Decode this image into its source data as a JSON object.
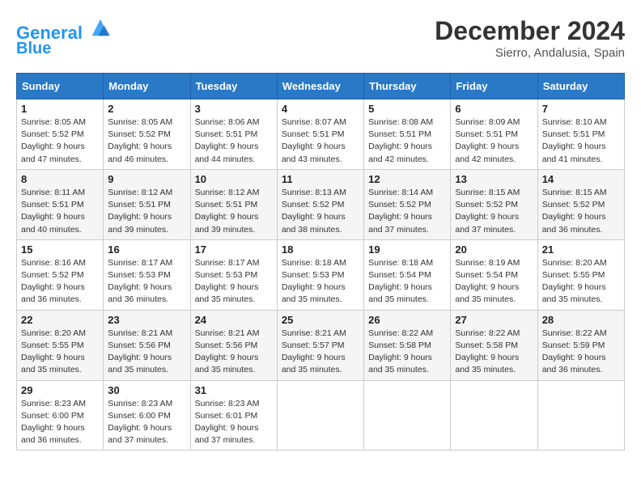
{
  "header": {
    "logo_line1": "General",
    "logo_line2": "Blue",
    "month_title": "December 2024",
    "location": "Sierro, Andalusia, Spain"
  },
  "calendar": {
    "headers": [
      "Sunday",
      "Monday",
      "Tuesday",
      "Wednesday",
      "Thursday",
      "Friday",
      "Saturday"
    ],
    "weeks": [
      [
        {
          "day": "1",
          "sunrise": "8:05 AM",
          "sunset": "5:52 PM",
          "daylight": "9 hours and 47 minutes."
        },
        {
          "day": "2",
          "sunrise": "8:05 AM",
          "sunset": "5:52 PM",
          "daylight": "9 hours and 46 minutes."
        },
        {
          "day": "3",
          "sunrise": "8:06 AM",
          "sunset": "5:51 PM",
          "daylight": "9 hours and 44 minutes."
        },
        {
          "day": "4",
          "sunrise": "8:07 AM",
          "sunset": "5:51 PM",
          "daylight": "9 hours and 43 minutes."
        },
        {
          "day": "5",
          "sunrise": "8:08 AM",
          "sunset": "5:51 PM",
          "daylight": "9 hours and 42 minutes."
        },
        {
          "day": "6",
          "sunrise": "8:09 AM",
          "sunset": "5:51 PM",
          "daylight": "9 hours and 42 minutes."
        },
        {
          "day": "7",
          "sunrise": "8:10 AM",
          "sunset": "5:51 PM",
          "daylight": "9 hours and 41 minutes."
        }
      ],
      [
        {
          "day": "8",
          "sunrise": "8:11 AM",
          "sunset": "5:51 PM",
          "daylight": "9 hours and 40 minutes."
        },
        {
          "day": "9",
          "sunrise": "8:12 AM",
          "sunset": "5:51 PM",
          "daylight": "9 hours and 39 minutes."
        },
        {
          "day": "10",
          "sunrise": "8:12 AM",
          "sunset": "5:51 PM",
          "daylight": "9 hours and 39 minutes."
        },
        {
          "day": "11",
          "sunrise": "8:13 AM",
          "sunset": "5:52 PM",
          "daylight": "9 hours and 38 minutes."
        },
        {
          "day": "12",
          "sunrise": "8:14 AM",
          "sunset": "5:52 PM",
          "daylight": "9 hours and 37 minutes."
        },
        {
          "day": "13",
          "sunrise": "8:15 AM",
          "sunset": "5:52 PM",
          "daylight": "9 hours and 37 minutes."
        },
        {
          "day": "14",
          "sunrise": "8:15 AM",
          "sunset": "5:52 PM",
          "daylight": "9 hours and 36 minutes."
        }
      ],
      [
        {
          "day": "15",
          "sunrise": "8:16 AM",
          "sunset": "5:52 PM",
          "daylight": "9 hours and 36 minutes."
        },
        {
          "day": "16",
          "sunrise": "8:17 AM",
          "sunset": "5:53 PM",
          "daylight": "9 hours and 36 minutes."
        },
        {
          "day": "17",
          "sunrise": "8:17 AM",
          "sunset": "5:53 PM",
          "daylight": "9 hours and 35 minutes."
        },
        {
          "day": "18",
          "sunrise": "8:18 AM",
          "sunset": "5:53 PM",
          "daylight": "9 hours and 35 minutes."
        },
        {
          "day": "19",
          "sunrise": "8:18 AM",
          "sunset": "5:54 PM",
          "daylight": "9 hours and 35 minutes."
        },
        {
          "day": "20",
          "sunrise": "8:19 AM",
          "sunset": "5:54 PM",
          "daylight": "9 hours and 35 minutes."
        },
        {
          "day": "21",
          "sunrise": "8:20 AM",
          "sunset": "5:55 PM",
          "daylight": "9 hours and 35 minutes."
        }
      ],
      [
        {
          "day": "22",
          "sunrise": "8:20 AM",
          "sunset": "5:55 PM",
          "daylight": "9 hours and 35 minutes."
        },
        {
          "day": "23",
          "sunrise": "8:21 AM",
          "sunset": "5:56 PM",
          "daylight": "9 hours and 35 minutes."
        },
        {
          "day": "24",
          "sunrise": "8:21 AM",
          "sunset": "5:56 PM",
          "daylight": "9 hours and 35 minutes."
        },
        {
          "day": "25",
          "sunrise": "8:21 AM",
          "sunset": "5:57 PM",
          "daylight": "9 hours and 35 minutes."
        },
        {
          "day": "26",
          "sunrise": "8:22 AM",
          "sunset": "5:58 PM",
          "daylight": "9 hours and 35 minutes."
        },
        {
          "day": "27",
          "sunrise": "8:22 AM",
          "sunset": "5:58 PM",
          "daylight": "9 hours and 35 minutes."
        },
        {
          "day": "28",
          "sunrise": "8:22 AM",
          "sunset": "5:59 PM",
          "daylight": "9 hours and 36 minutes."
        }
      ],
      [
        {
          "day": "29",
          "sunrise": "8:23 AM",
          "sunset": "6:00 PM",
          "daylight": "9 hours and 36 minutes."
        },
        {
          "day": "30",
          "sunrise": "8:23 AM",
          "sunset": "6:00 PM",
          "daylight": "9 hours and 37 minutes."
        },
        {
          "day": "31",
          "sunrise": "8:23 AM",
          "sunset": "6:01 PM",
          "daylight": "9 hours and 37 minutes."
        },
        null,
        null,
        null,
        null
      ]
    ]
  }
}
